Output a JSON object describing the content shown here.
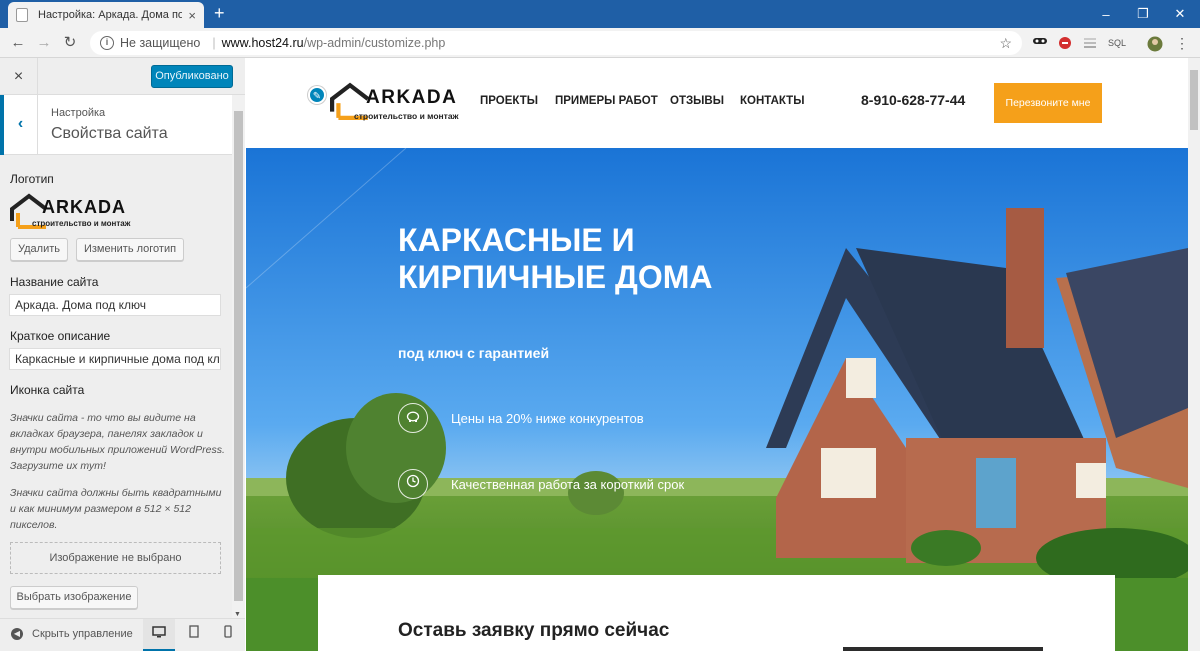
{
  "browser": {
    "tab_title": "Настройка: Аркада. Дома под к",
    "tab_close": "×",
    "new_tab": "+",
    "minimize": "–",
    "restore": "❐",
    "close": "✕",
    "security_text": "Не защищено",
    "url_host": "www.host24.ru",
    "url_path": "/wp-admin/customize.php",
    "ext_sql": "SQL"
  },
  "customizer": {
    "close": "×",
    "publish_label": "Опубликовано",
    "back": "‹",
    "breadcrumb": "Настройка",
    "section_title": "Свойства сайта",
    "logo_label": "Логотип",
    "logo_brand": "ARKADA",
    "logo_tagline": "строительство и монтаж",
    "remove_label": "Удалить",
    "change_logo_label": "Изменить логотип",
    "site_title_label": "Название сайта",
    "site_title_value": "Аркада. Дома под ключ",
    "tagline_label": "Краткое описание",
    "tagline_value": "Каркасные и кирпичные дома под ключ",
    "site_icon_label": "Иконка сайта",
    "site_icon_desc1": "Значки сайта - то что вы видите на вкладках браузера, панелях закладок и внутри мобильных приложений WordPress. Загрузите их тут!",
    "site_icon_desc2": "Значки сайта должны быть квадратными и как минимум размером в 512 × 512 пикселов.",
    "no_image": "Изображение не выбрано",
    "select_image": "Выбрать изображение",
    "hide_controls": "Скрыть управление"
  },
  "site": {
    "brand": "ARKADA",
    "tagline": "строительство и монтаж",
    "nav": [
      "ПРОЕКТЫ",
      "ПРИМЕРЫ РАБОТ",
      "ОТЗЫВЫ",
      "КОНТАКТЫ"
    ],
    "phone": "8-910-628-77-44",
    "cta": "Перезвоните мне",
    "hero_title": "Каркасные и кирпичные дома",
    "hero_sub": "под ключ с гарантией",
    "features": [
      "Цены на 20% ниже конкурентов",
      "Качественная работа за короткий срок"
    ],
    "form_title": "Оставь заявку прямо сейчас"
  }
}
